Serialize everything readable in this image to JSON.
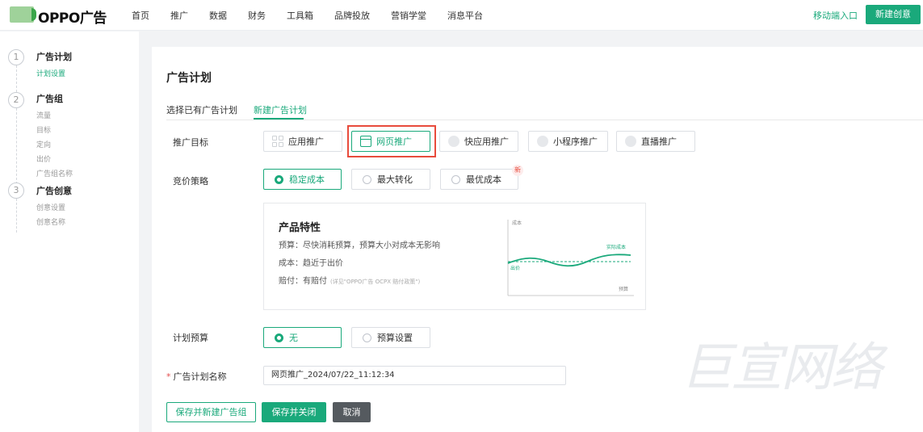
{
  "header": {
    "logo": "OPPO广告",
    "nav": [
      "首页",
      "推广",
      "数据",
      "财务",
      "工具箱",
      "品牌投放",
      "营销学堂",
      "消息平台"
    ],
    "mobile_link": "移动端入口",
    "new_creative": "新建创意"
  },
  "sidebar": {
    "steps": [
      {
        "num": "1",
        "title": "广告计划",
        "subs": [
          "计划设置"
        ]
      },
      {
        "num": "2",
        "title": "广告组",
        "subs": [
          "流量",
          "目标",
          "定向",
          "出价",
          "广告组名称"
        ]
      },
      {
        "num": "3",
        "title": "广告创意",
        "subs": [
          "创意设置",
          "创意名称"
        ]
      }
    ]
  },
  "main": {
    "title": "广告计划",
    "tabs": [
      "选择已有广告计划",
      "新建广告计划"
    ],
    "active_tab": 1,
    "goal": {
      "label": "推广目标",
      "options": [
        "应用推广",
        "网页推广",
        "快应用推广",
        "小程序推广",
        "直播推广"
      ],
      "selected": 1
    },
    "bid": {
      "label": "竞价策略",
      "options": [
        "稳定成本",
        "最大转化",
        "最优成本"
      ],
      "selected": 0,
      "new_badge": "新"
    },
    "feature": {
      "title": "产品特性",
      "lines": [
        "预算：尽快消耗预算，预算大小对成本无影响",
        "成本：趋近于出价",
        "赔付：有赔付"
      ],
      "note": "(详见\"OPPO广告 OCPX 赔付政策\")",
      "chart": {
        "y_label": "成本",
        "x_label": "预算",
        "actual_label": "实际成本",
        "bid_label": "出价"
      }
    },
    "budget": {
      "label": "计划预算",
      "options": [
        "无",
        "预算设置"
      ],
      "selected": 0
    },
    "name": {
      "label": "广告计划名称",
      "required": "*",
      "value": "网页推广_2024/07/22_11:12:34"
    },
    "buttons": {
      "save_new": "保存并新建广告组",
      "save_close": "保存并关闭",
      "cancel": "取消"
    }
  },
  "watermark": "巨宣网络",
  "colors": {
    "accent": "#1aa97b",
    "highlight": "#e84b3c"
  }
}
